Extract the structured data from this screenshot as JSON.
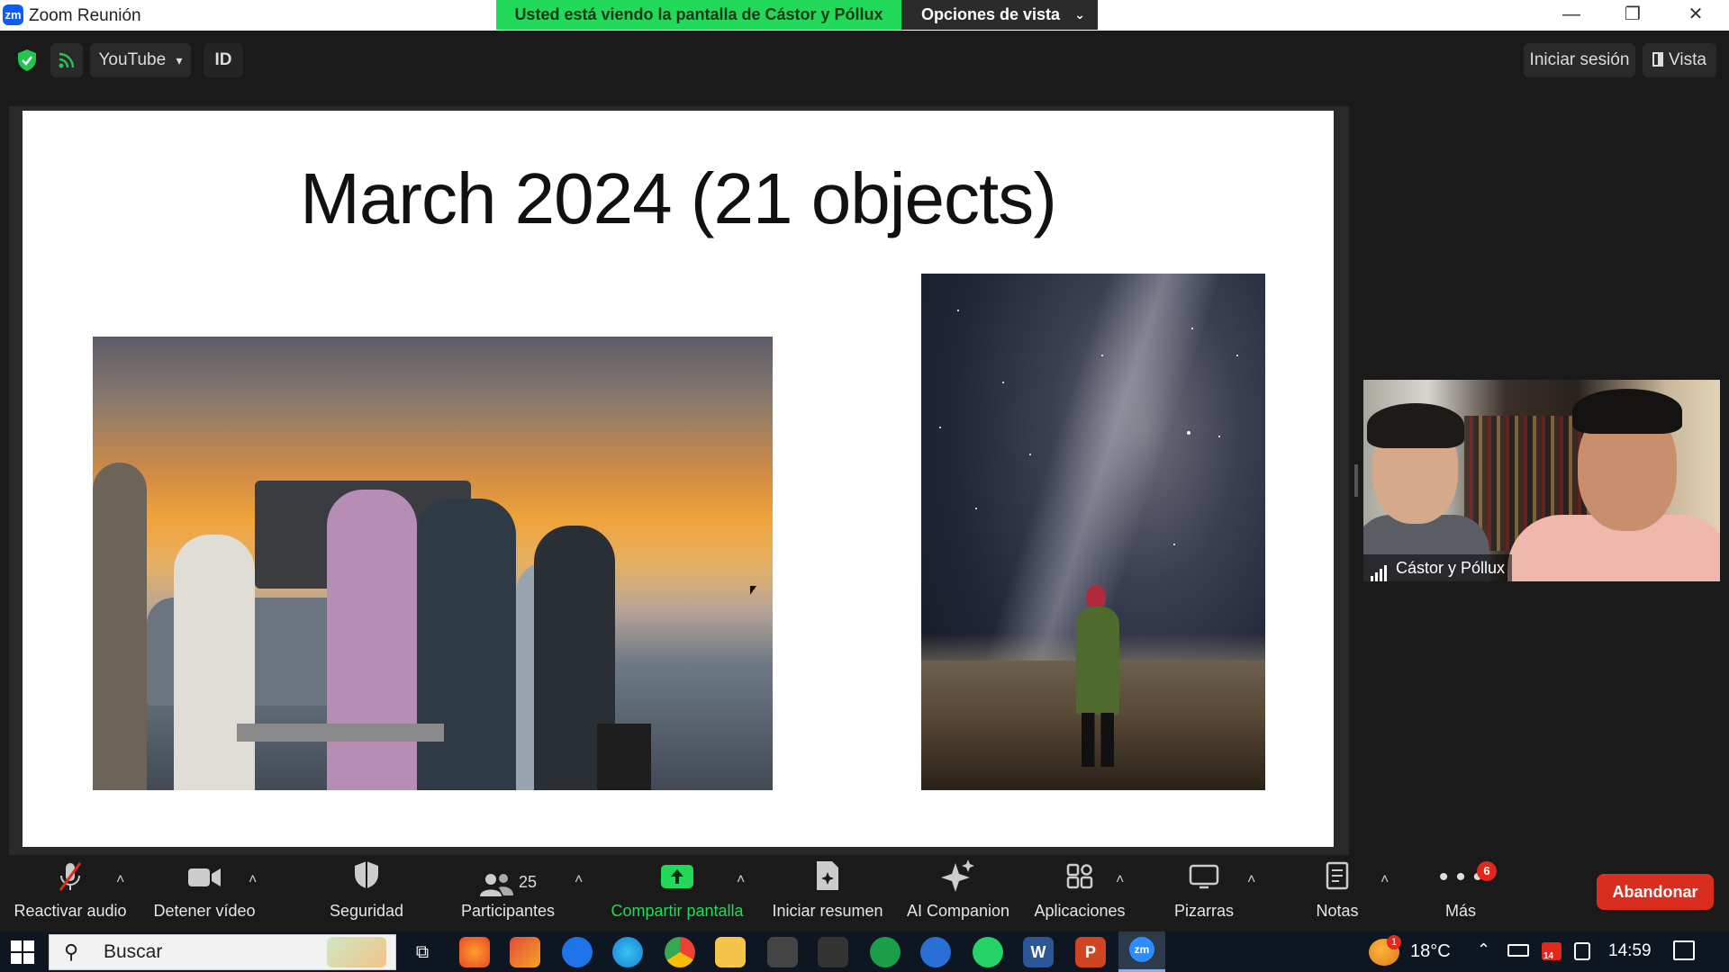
{
  "window": {
    "app_logo": "zm",
    "title": "Zoom Reunión",
    "share_banner": "Usted está viendo la pantalla de Cástor y Póllux",
    "view_options_label": "Opciones de vista",
    "view_options_caret": "⌄",
    "minimize_glyph": "—",
    "restore_glyph": "❐",
    "close_glyph": "✕"
  },
  "topbar": {
    "youtube_label": "YouTube",
    "youtube_caret": "▾",
    "id_label": "ID",
    "signin_label": "Iniciar sesión",
    "view_label": "Vista"
  },
  "slide": {
    "title": "March 2024 (21 objects)"
  },
  "video": {
    "participant_name": "Cástor y Póllux"
  },
  "toolbar": {
    "items": [
      {
        "label": "Reactivar audio",
        "icon": "mic-muted-icon"
      },
      {
        "label": "Detener vídeo",
        "icon": "video-camera-icon"
      },
      {
        "label": "Seguridad",
        "icon": "shield-icon"
      },
      {
        "label": "Participantes",
        "icon": "participants-icon",
        "count": "25"
      },
      {
        "label": "Compartir pantalla",
        "icon": "share-screen-icon"
      },
      {
        "label": "Iniciar resumen",
        "icon": "summary-icon"
      },
      {
        "label": "AI Companion",
        "icon": "sparkle-icon"
      },
      {
        "label": "Aplicaciones",
        "icon": "apps-icon"
      },
      {
        "label": "Pizarras",
        "icon": "whiteboard-icon"
      },
      {
        "label": "Notas",
        "icon": "notes-icon"
      },
      {
        "label": "Más",
        "icon": "more-icon"
      }
    ],
    "more_badge": "6",
    "leave_label": "Abandonar",
    "caret": "˄",
    "share_color": "#23d959"
  },
  "taskbar": {
    "search_placeholder": "Buscar",
    "weather_badge": "1",
    "temperature": "18°C",
    "calendar_badge": "14",
    "time": "14:59"
  }
}
